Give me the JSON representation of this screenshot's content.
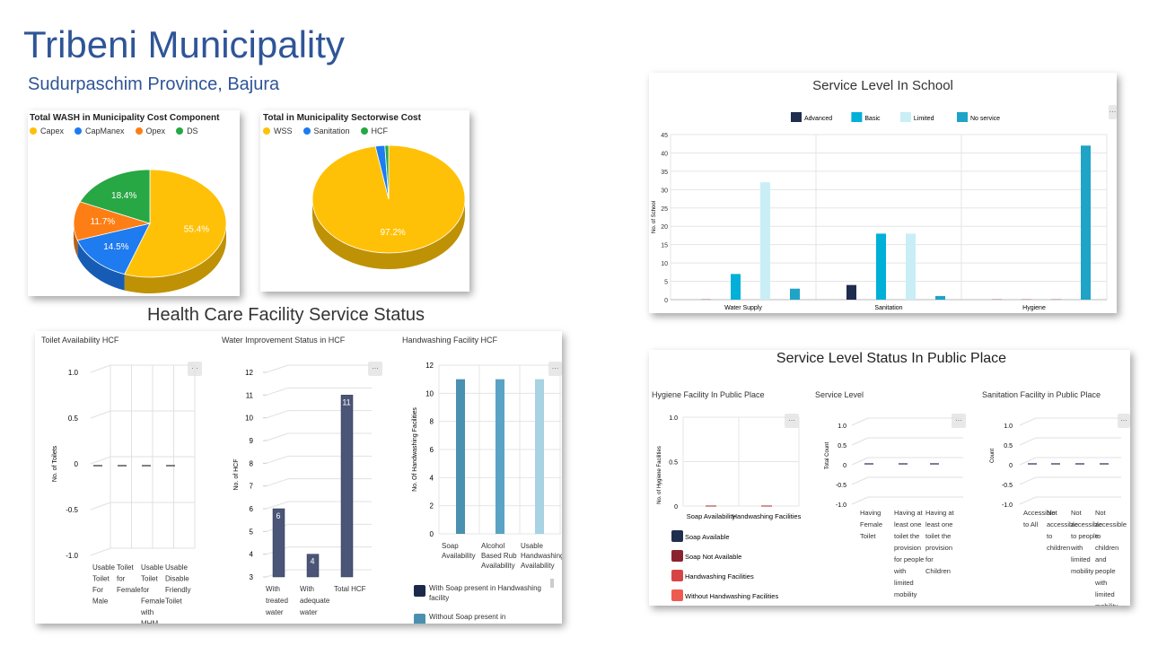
{
  "header": {
    "title": "Tribeni Municipality",
    "subtitle": "Sudurpaschim Province, Bajura"
  },
  "chart_data": [
    {
      "id": "wash_cost",
      "type": "pie",
      "title": "Total WASH in Municipality Cost Component",
      "categories": [
        "Capex",
        "CapManex",
        "Opex",
        "DS"
      ],
      "values": [
        55.4,
        14.5,
        11.7,
        18.4
      ],
      "labels": [
        "55.4%",
        "14.5%",
        "11.7%",
        "18.4%"
      ],
      "colors": [
        "#ffc107",
        "#1e7bf0",
        "#fd7e14",
        "#28a745"
      ]
    },
    {
      "id": "sector_cost",
      "type": "pie",
      "title": "Total in Municipality Sectorwise Cost",
      "categories": [
        "WSS",
        "Sanitation",
        "HCF"
      ],
      "values": [
        97.2,
        2.0,
        0.8
      ],
      "labels": [
        "97.2%",
        "",
        ""
      ],
      "colors": [
        "#ffc107",
        "#1e7bf0",
        "#28a745"
      ]
    },
    {
      "id": "school",
      "type": "bar",
      "title": "Service Level In School",
      "categories": [
        "Water Supply",
        "Sanitation",
        "Hygiene"
      ],
      "series": [
        {
          "name": "Advanced",
          "values": [
            0,
            4,
            0
          ],
          "color": "#1f2d4e"
        },
        {
          "name": "Basic",
          "values": [
            7,
            18,
            0
          ],
          "color": "#00b0d8"
        },
        {
          "name": "Limited",
          "values": [
            32,
            18,
            0
          ],
          "color": "#c9eef6"
        },
        {
          "name": "No service",
          "values": [
            3,
            1,
            42
          ],
          "color": "#1fa3c6"
        }
      ],
      "ylabel": "No. of School",
      "ylim": [
        0,
        45
      ],
      "yticks": [
        "0",
        "5",
        "10",
        "15",
        "20",
        "25",
        "30",
        "35",
        "40",
        "45"
      ]
    },
    {
      "id": "toilet_hcf",
      "type": "line",
      "title": "Toilet Availability HCF",
      "categories": [
        "Usable Toilet For Male",
        "Toilet for Female",
        "Usable Toilet for Female with MHM Facility",
        "Usable Disable Friendly Toilet"
      ],
      "values": [
        0,
        0,
        0,
        0
      ],
      "ylabel": "No. of Toilets",
      "ylim": [
        -1.0,
        1.0
      ],
      "yticks": [
        "1.0",
        "0.5",
        "0",
        "-0.5",
        "-1.0"
      ]
    },
    {
      "id": "water_hcf",
      "type": "bar",
      "title": "Water Improvement Status in HCF",
      "categories": [
        "With treated water",
        "With adequate water",
        "Total HCF"
      ],
      "values": [
        6,
        4,
        11
      ],
      "value_labels": [
        "6",
        "4",
        "11"
      ],
      "color": "#4a5577",
      "ylabel": "No. of HCF",
      "ylim": [
        3,
        12
      ],
      "yticks": [
        "12",
        "11",
        "10",
        "9",
        "8",
        "7",
        "6",
        "5",
        "4",
        "3"
      ]
    },
    {
      "id": "handwash_hcf",
      "type": "bar",
      "title": "Handwashing Facility HCF",
      "categories": [
        "Soap Availability",
        "Alcohol Based Rub Availability",
        "Usable Handwashing Availability"
      ],
      "values": [
        11,
        11,
        11
      ],
      "colors": [
        "#4a90b0",
        "#5aa3c4",
        "#a7d3e3"
      ],
      "ylabel": "No. Of Handwashing Facilities",
      "ylim": [
        0,
        12
      ],
      "yticks": [
        "12",
        "10",
        "8",
        "6",
        "4",
        "2",
        "0"
      ],
      "legend": [
        {
          "name": "With Soap present in Handwashing facility",
          "color": "#1b2a4a"
        },
        {
          "name": "Without Soap present in",
          "color": "#4a90b0"
        }
      ]
    },
    {
      "id": "hygiene_public",
      "type": "bar",
      "title": "Hygiene Facility In Public Place",
      "categories": [
        "Soap Availability",
        "Handwashing Facilities"
      ],
      "values": [
        0,
        0
      ],
      "ylabel": "No. of Hygiene Facilities",
      "ylim": [
        0,
        1.0
      ],
      "yticks": [
        "1.0",
        "0.5",
        "0"
      ],
      "legend": [
        {
          "name": "Soap Available",
          "color": "#1f2d4e"
        },
        {
          "name": "Soap Not Available",
          "color": "#8b2230"
        },
        {
          "name": "Handwashing Facilities",
          "color": "#d64545"
        },
        {
          "name": "Without Handwashing Facilities",
          "color": "#ee5a50"
        }
      ]
    },
    {
      "id": "service_level_public",
      "type": "line",
      "title": "Service Level",
      "categories": [
        "Having Female Toilet",
        "Having at least one toilet the provision for people with limited mobility",
        "Having at least one toilet the provision for Children"
      ],
      "values": [
        0,
        0,
        0
      ],
      "ylabel": "Total Count",
      "ylim": [
        -1.0,
        1.0
      ],
      "yticks": [
        "1.0",
        "0.5",
        "0",
        "-0.5",
        "-1.0"
      ]
    },
    {
      "id": "sanitation_public",
      "type": "line",
      "title": "Sanitation Facility in Public Place",
      "categories": [
        "Accessible to All",
        "Not accessible to children",
        "Not accessible to people with limited mobility",
        "Not accessible to children and people with limited mobility"
      ],
      "values": [
        0,
        0,
        0,
        0
      ],
      "ylabel": "Count",
      "ylim": [
        -1.0,
        1.0
      ],
      "yticks": [
        "1.0",
        "0.5",
        "0",
        "-0.5",
        "-1.0"
      ]
    }
  ],
  "sections": {
    "hcf_title": "Health Care Facility Service Status",
    "public_title": "Service Level Status In Public Place"
  },
  "menu_glyph": "..."
}
